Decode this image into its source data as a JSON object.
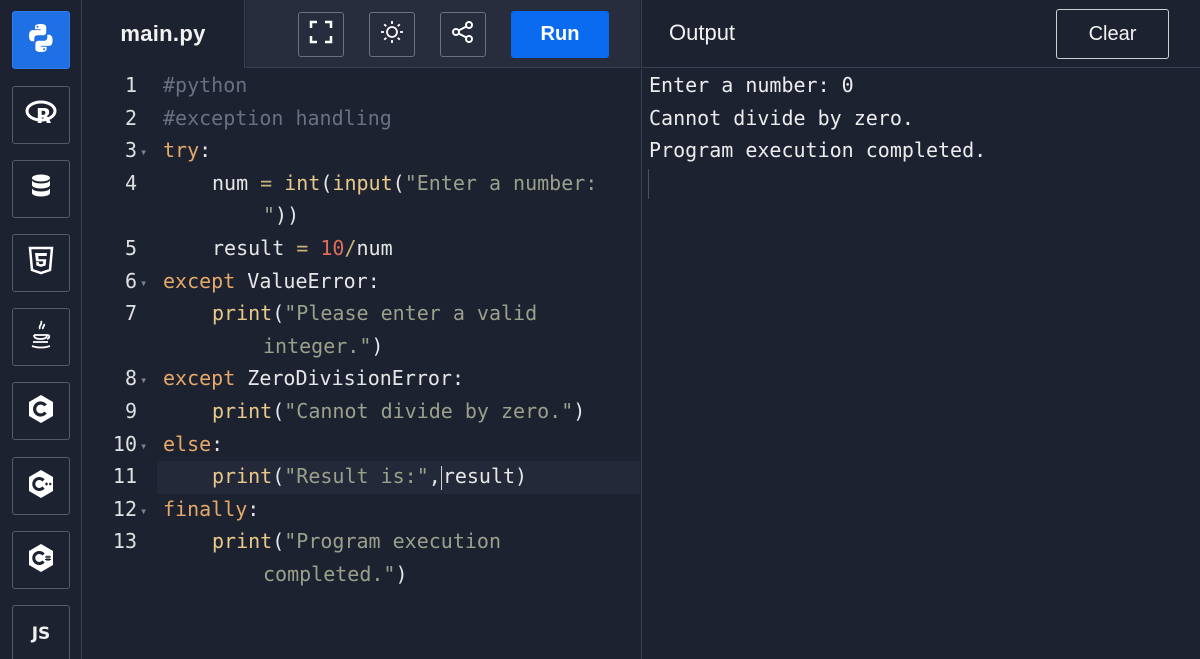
{
  "sidebar": {
    "languages": [
      {
        "name": "python-icon",
        "label": "",
        "active": true
      },
      {
        "name": "r-icon",
        "label": ""
      },
      {
        "name": "database-icon",
        "label": ""
      },
      {
        "name": "html5-icon",
        "label": ""
      },
      {
        "name": "java-icon",
        "label": ""
      },
      {
        "name": "c-icon",
        "label": ""
      },
      {
        "name": "cpp-icon",
        "label": ""
      },
      {
        "name": "csharp-icon",
        "label": ""
      },
      {
        "name": "js-icon",
        "label": "JS"
      }
    ]
  },
  "toolbar": {
    "file_tab": "main.py",
    "fullscreen_icon": "fullscreen-icon",
    "theme_icon": "sun-icon",
    "share_icon": "share-icon",
    "run_label": "Run"
  },
  "output_panel": {
    "title": "Output",
    "clear_label": "Clear",
    "lines": [
      "Enter a number: 0",
      "Cannot divide by zero.",
      "Program execution completed."
    ]
  },
  "editor": {
    "line_numbers": [
      "1",
      "2",
      "3",
      "4",
      "5",
      "6",
      "7",
      "8",
      "9",
      "10",
      "11",
      "12",
      "13"
    ],
    "code": {
      "l1": "#python",
      "l2": "#exception handling",
      "l3_kw": "try",
      "l4_var": "num",
      "l4_eq": " = ",
      "l4_fn1": "int",
      "l4_p1": "(",
      "l4_fn2": "input",
      "l4_p2": "(",
      "l4_str1": "\"Enter a number:",
      "l4_str2": "\"",
      "l4_close": "))",
      "l5_var": "result",
      "l5_eq": " = ",
      "l5_num": "10",
      "l5_op": "/",
      "l5_rest": "num",
      "l6_kw": "except",
      "l6_rest": " ValueError:",
      "l7_fn": "print",
      "l7_p": "(",
      "l7_str1": "\"Please enter a valid",
      "l7_str2": "integer.\"",
      "l7_close": ")",
      "l8_kw": "except",
      "l8_rest": " ZeroDivisionError:",
      "l9_fn": "print",
      "l9_p": "(",
      "l9_str": "\"Cannot divide by zero.\"",
      "l9_close": ")",
      "l10_kw": "else",
      "l11_fn": "print",
      "l11_p": "(",
      "l11_str": "\"Result is:\"",
      "l11_rest": "result)",
      "l11_comma": ",",
      "l12_kw": "finally",
      "l13_fn": "print",
      "l13_p": "(",
      "l13_str1": "\"Program execution",
      "l13_str2": "completed.\"",
      "l13_close": ")",
      "colon": ":"
    }
  }
}
